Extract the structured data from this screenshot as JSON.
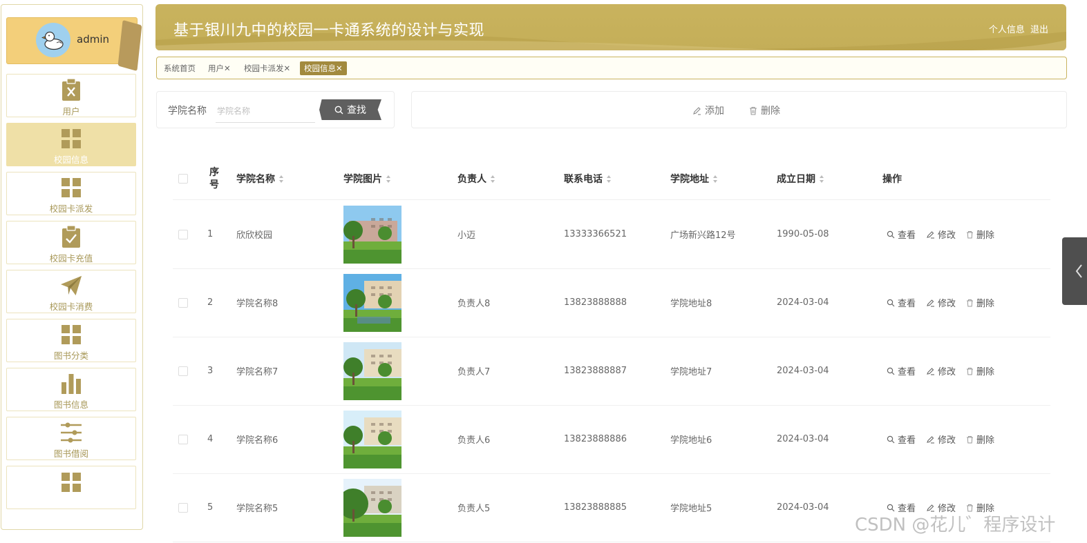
{
  "user": {
    "name": "admin",
    "avatar_icon": "duck-avatar-icon"
  },
  "sidebar": {
    "items": [
      {
        "label": "用户",
        "icon": "clipboard-x-icon",
        "active": false
      },
      {
        "label": "校园信息",
        "icon": "grid-icon",
        "active": true
      },
      {
        "label": "校园卡派发",
        "icon": "grid-icon",
        "active": false
      },
      {
        "label": "校园卡充值",
        "icon": "clipboard-check-icon",
        "active": false
      },
      {
        "label": "校园卡消费",
        "icon": "paper-plane-icon",
        "active": false
      },
      {
        "label": "图书分类",
        "icon": "grid-icon",
        "active": false
      },
      {
        "label": "图书信息",
        "icon": "bar-chart-icon",
        "active": false
      },
      {
        "label": "图书借阅",
        "icon": "sliders-icon",
        "active": false
      },
      {
        "label": "",
        "icon": "grid-icon",
        "active": false
      }
    ]
  },
  "header": {
    "title": "基于银川九中的校园一卡通系统的设计与实现",
    "profile_link": "个人信息",
    "logout_link": "退出"
  },
  "tabs": [
    {
      "label": "系统首页",
      "closable": false,
      "active": false
    },
    {
      "label": "用户",
      "closable": true,
      "active": false
    },
    {
      "label": "校园卡派发",
      "closable": true,
      "active": false
    },
    {
      "label": "校园信息",
      "closable": true,
      "active": true
    }
  ],
  "search": {
    "label": "学院名称",
    "placeholder": "学院名称",
    "value": "",
    "button_label": "查找"
  },
  "actions": {
    "add_label": "添加",
    "delete_label": "删除"
  },
  "table": {
    "columns": {
      "index": "序号",
      "name": "学院名称",
      "image": "学院图片",
      "leader": "负责人",
      "phone": "联系电话",
      "address": "学院地址",
      "date": "成立日期",
      "ops": "操作"
    },
    "op_labels": {
      "view": "查看",
      "edit": "修改",
      "delete": "删除"
    },
    "rows": [
      {
        "index": "1",
        "name": "欣欣校园",
        "leader": "小迈",
        "phone": "13333366521",
        "address": "广场新兴路12号",
        "date": "1990-05-08"
      },
      {
        "index": "2",
        "name": "学院名称8",
        "leader": "负责人8",
        "phone": "13823888888",
        "address": "学院地址8",
        "date": "2024-03-04"
      },
      {
        "index": "3",
        "name": "学院名称7",
        "leader": "负责人7",
        "phone": "13823888887",
        "address": "学院地址7",
        "date": "2024-03-04"
      },
      {
        "index": "4",
        "name": "学院名称6",
        "leader": "负责人6",
        "phone": "13823888886",
        "address": "学院地址6",
        "date": "2024-03-04"
      },
      {
        "index": "5",
        "name": "学院名称5",
        "leader": "负责人5",
        "phone": "13823888885",
        "address": "学院地址5",
        "date": "2024-03-04"
      }
    ]
  },
  "colors": {
    "accent": "#c4ae58",
    "active_tab": "#a28a3e",
    "sidebar_active": "#efe0a7",
    "icon": "#b09b5a"
  },
  "watermark": "CSDN @花儿゛程序设计"
}
